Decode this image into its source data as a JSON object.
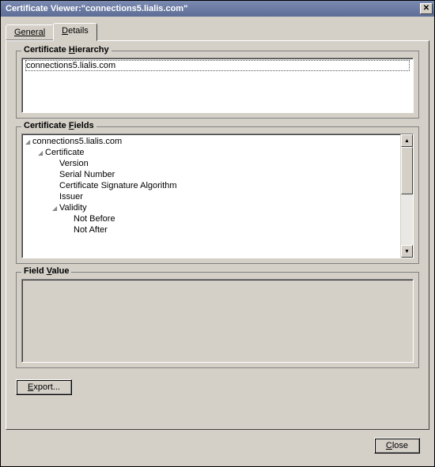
{
  "window": {
    "title": "Certificate Viewer:\"connections5.lialis.com\"",
    "close_glyph": "✕"
  },
  "tabs": {
    "general": "General",
    "details": "Details",
    "active": "details"
  },
  "sections": {
    "hierarchy_label": "Certificate Hierarchy",
    "fields_label": "Certificate Fields",
    "value_label": "Field Value"
  },
  "hierarchy": {
    "items": [
      "connections5.lialis.com"
    ]
  },
  "fields_tree": [
    {
      "label": "connections5.lialis.com",
      "depth": 0,
      "expanded": true
    },
    {
      "label": "Certificate",
      "depth": 1,
      "expanded": true
    },
    {
      "label": "Version",
      "depth": 2
    },
    {
      "label": "Serial Number",
      "depth": 2
    },
    {
      "label": "Certificate Signature Algorithm",
      "depth": 2
    },
    {
      "label": "Issuer",
      "depth": 2
    },
    {
      "label": "Validity",
      "depth": 2,
      "expanded": true
    },
    {
      "label": "Not Before",
      "depth": 3
    },
    {
      "label": "Not After",
      "depth": 3
    }
  ],
  "field_value": "",
  "buttons": {
    "export": "Export...",
    "close": "Close"
  },
  "scroll": {
    "up": "▲",
    "down": "▼"
  }
}
